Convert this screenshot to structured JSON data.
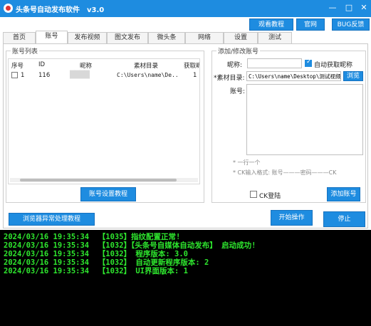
{
  "window": {
    "title": "头条号自动发布软件",
    "version": "v3.0",
    "controls": {
      "minimize": "—",
      "maximize": "□",
      "close": "✕"
    }
  },
  "top_buttons": {
    "tutorial": "观看教程",
    "website": "官网",
    "bug": "BUG反馈"
  },
  "tabs": [
    "首页",
    "账号",
    "发布视频",
    "图文发布",
    "微头条",
    "网络",
    "设置",
    "测试"
  ],
  "active_tab": "账号",
  "account_list": {
    "title": "账号列表",
    "columns": [
      "序号",
      "ID",
      "昵称",
      "素材目录",
      "获取昵"
    ],
    "rows": [
      {
        "index": "1",
        "id": "116",
        "nickname": "████",
        "dir": "C:\\Users\\name\\De..",
        "fetch": "1"
      }
    ],
    "tutorial_button": "账号设置教程"
  },
  "edit_panel": {
    "title": "添加/修改账号",
    "nickname_label": "昵称:",
    "nickname_value": "",
    "auto_fetch_label": "自动获取昵称",
    "auto_fetch_checked": true,
    "material_label": "*素材目录:",
    "material_value": "C:\\Users\\name\\Desktop\\测试视频",
    "browse": "浏览",
    "account_label": "账号:",
    "hint1": "* 一行一个",
    "hint2": "* CK输入格式: 账号———密码———CK",
    "ck_login_label": "CK登陆",
    "ck_login_checked": false,
    "add_button": "添加账号"
  },
  "bottom": {
    "browser_fix": "浏览器异常处理教程",
    "start": "开始操作",
    "stop": "停止"
  },
  "console": [
    "2024/03/16 19:35:34  【1035】指纹配置正常!",
    "2024/03/16 19:35:34  【1032】【头条号自媒体自动发布】 启动成功!",
    "2024/03/16 19:35:34  【1032】 程序版本: 3.0",
    "2024/03/16 19:35:34  【1032】 自动更新程序版本: 2",
    "2024/03/16 19:35:34  【1032】 UI界面版本: 1"
  ],
  "colors": {
    "accent": "#1e8ce0",
    "console_bg": "#000000",
    "console_text": "#2ee62e"
  }
}
